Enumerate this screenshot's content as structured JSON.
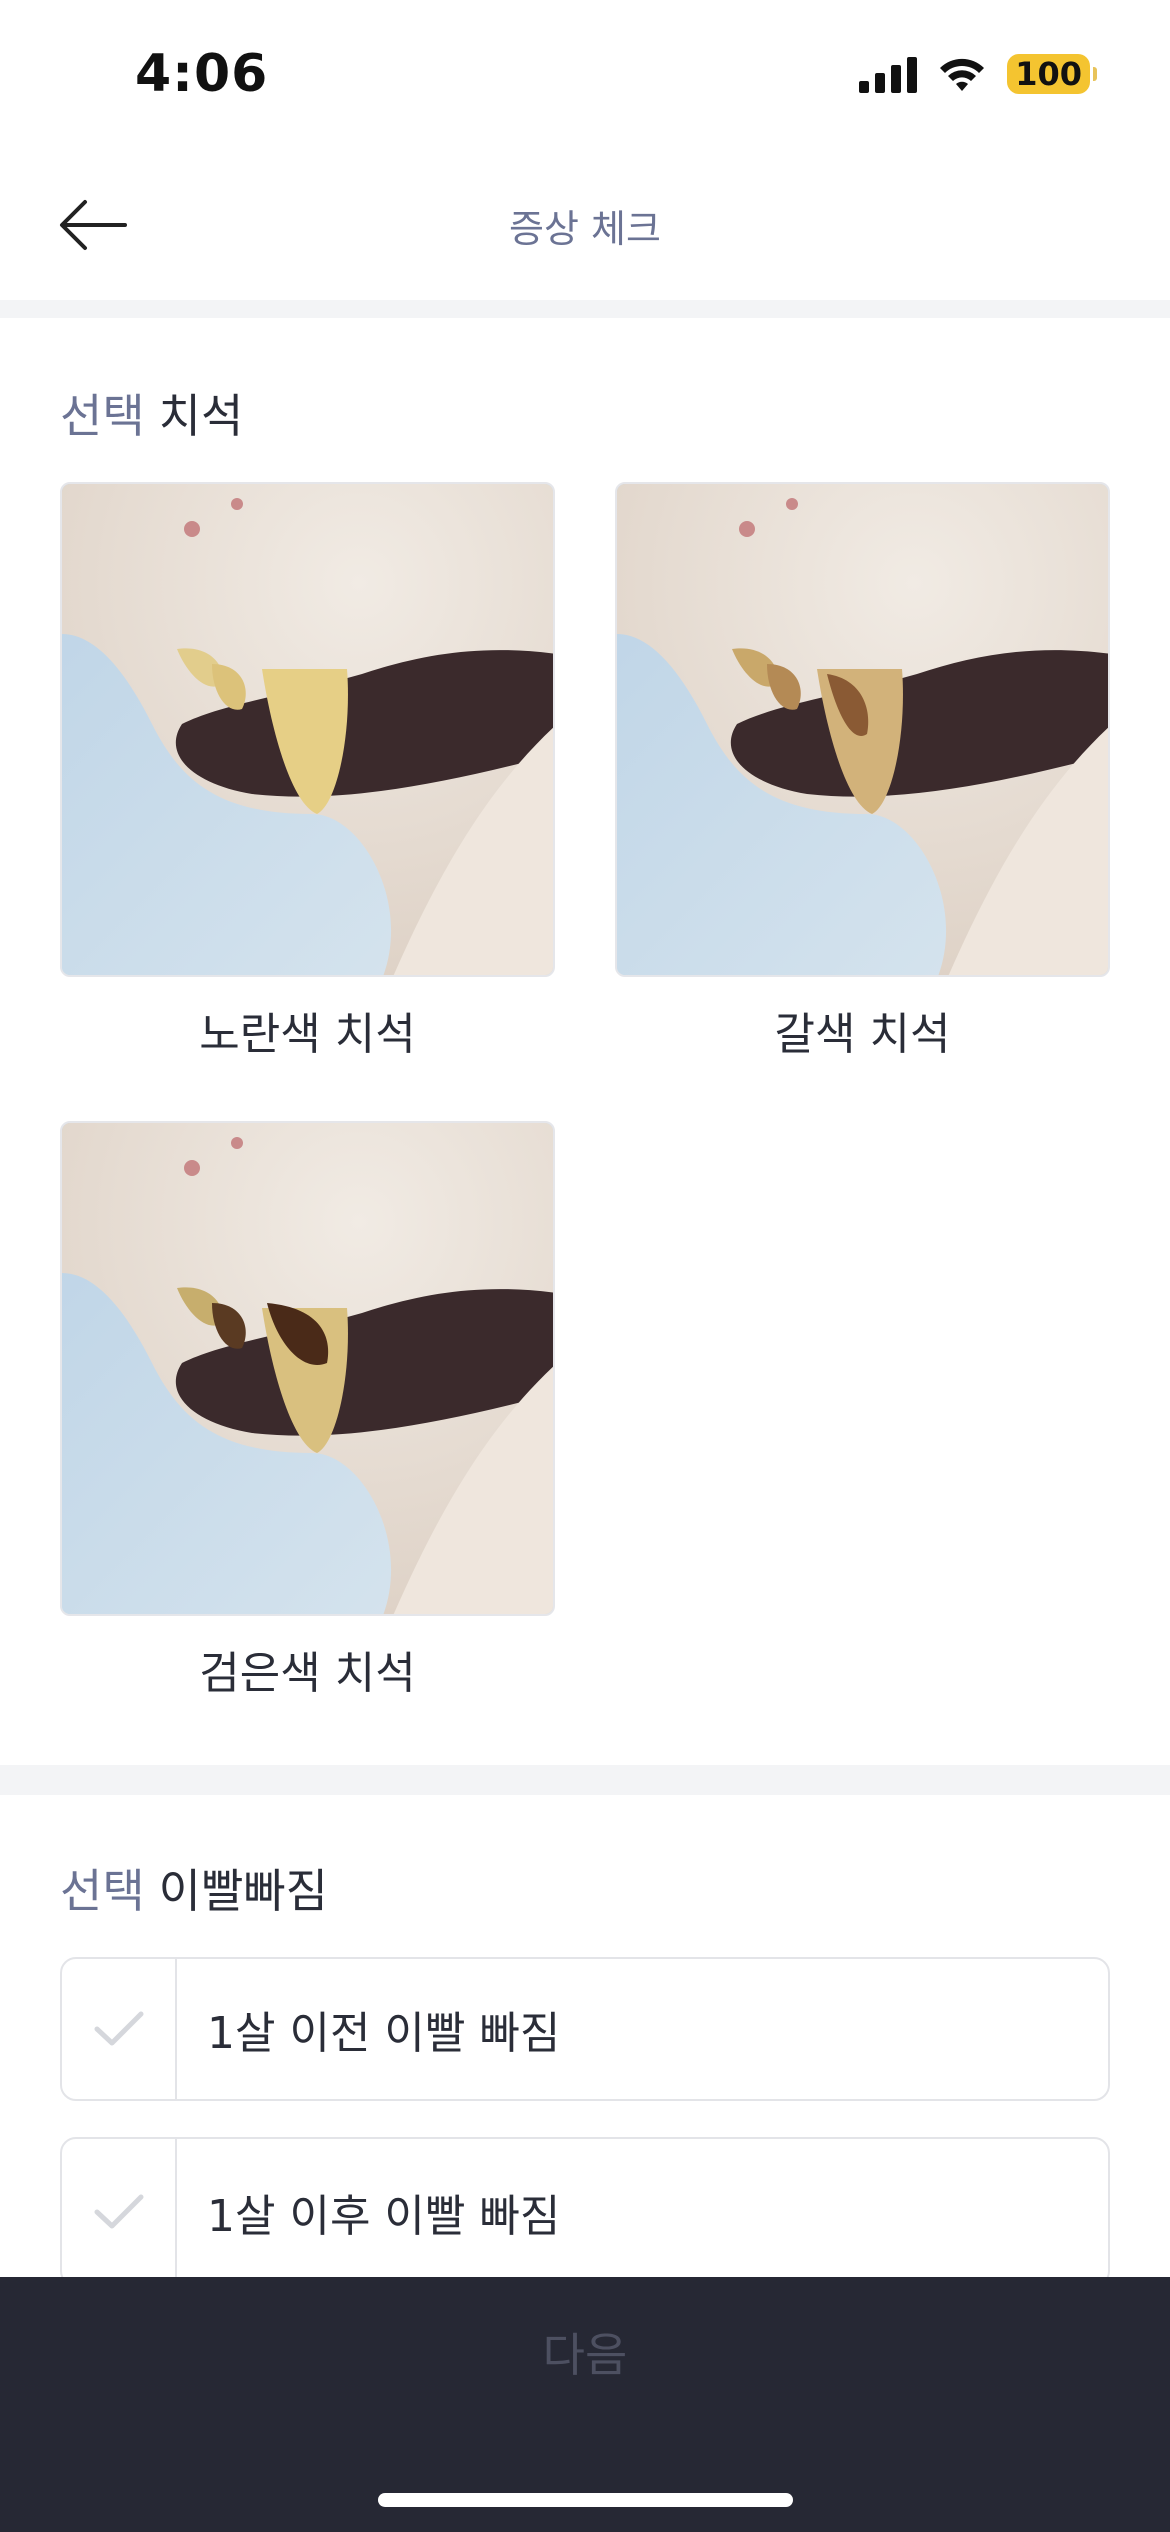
{
  "status_bar": {
    "time": "4:06",
    "battery": "100",
    "icons": [
      "signal-icon",
      "wifi-icon",
      "battery-icon"
    ]
  },
  "header": {
    "title": "증상 체크",
    "back_icon": "arrow-left-icon"
  },
  "tartar_section": {
    "optional_label": "선택",
    "title": "치석",
    "options": [
      {
        "label": "노란색 치석"
      },
      {
        "label": "갈색 치석"
      },
      {
        "label": "검은색 치석"
      }
    ]
  },
  "tooth_loss_section": {
    "optional_label": "선택",
    "title": "이빨빠짐",
    "options": [
      {
        "label": "1살 이전 이빨 빠짐",
        "checked": false
      },
      {
        "label": "1살 이후 이빨 빠짐",
        "checked": false
      }
    ]
  },
  "footer": {
    "next_label": "다음"
  },
  "colors": {
    "accent_muted": "#6b7394",
    "bottom_bar": "#262834",
    "battery": "#f4c430"
  }
}
